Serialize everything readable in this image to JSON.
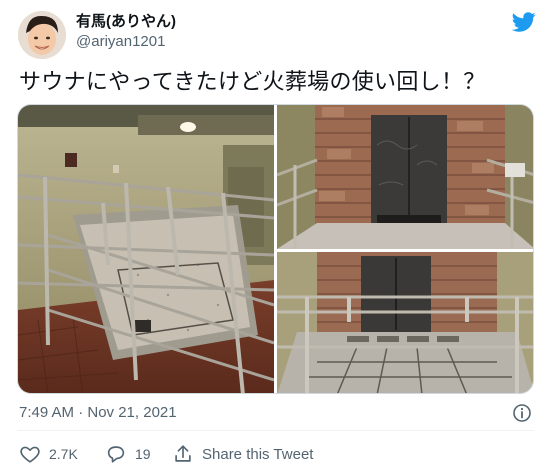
{
  "author": {
    "display_name": "有馬(ありやん)",
    "handle": "@ariyan1201"
  },
  "tweet": {
    "text": "サウナにやってきたけど火葬場の使い回し！？",
    "timestamp": "7:49 AM · Nov 21, 2021"
  },
  "actions": {
    "like_count": "2.7K",
    "reply_count": "19",
    "share_label": "Share this Tweet"
  },
  "colors": {
    "twitter_blue": "#1d9bf0",
    "text_primary": "#0f1419",
    "text_secondary": "#536471",
    "border": "#cfd9de"
  },
  "icons": {
    "brand": "twitter-bird-icon",
    "info": "info-icon",
    "like": "heart-icon",
    "reply": "reply-icon",
    "share": "share-icon"
  }
}
